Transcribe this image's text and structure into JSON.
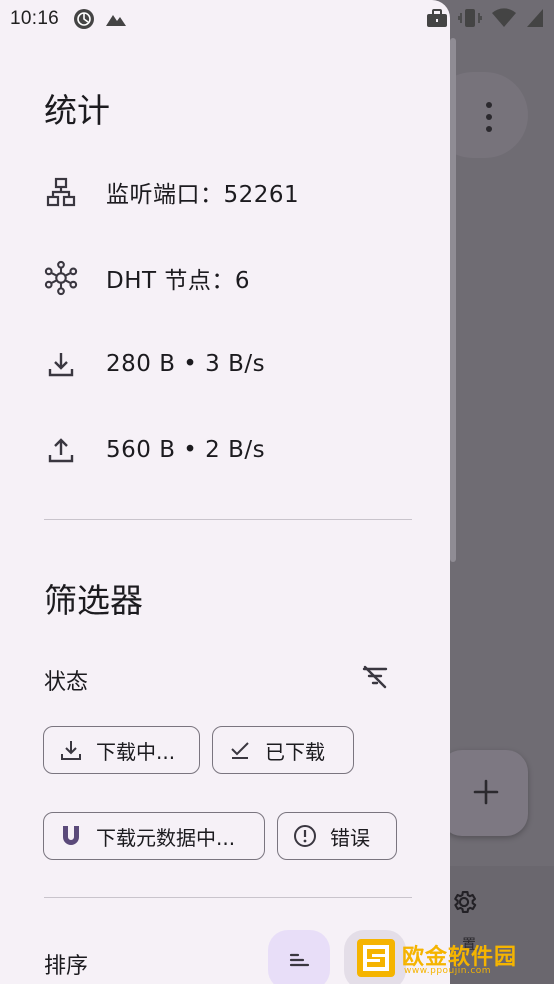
{
  "status_bar": {
    "time": "10:16"
  },
  "stats": {
    "title": "统计",
    "listen_port": "监听端口：52261",
    "dht_nodes": "DHT 节点：6",
    "download": "280 B • 3 B/s",
    "upload": "560 B • 2 B/s"
  },
  "filters": {
    "title": "筛选器",
    "state_label": "状态",
    "chips": [
      {
        "label": "下载中...",
        "icon": "download-icon"
      },
      {
        "label": "已下载",
        "icon": "check-icon"
      },
      {
        "label": "下载元数据中...",
        "icon": "magnet-icon"
      },
      {
        "label": "错误",
        "icon": "error-icon"
      }
    ]
  },
  "sort": {
    "label": "排序"
  },
  "background": {
    "settings_label": "置"
  },
  "watermark": {
    "text": "欧金软件园",
    "sub": "www.ppoujin.com"
  },
  "colors": {
    "drawer_bg": "#f6f1f7",
    "scrim": "#6f6c73",
    "chip_border": "#7a757f",
    "sort_active_bg": "#e8def8",
    "watermark": "#f5b400"
  }
}
